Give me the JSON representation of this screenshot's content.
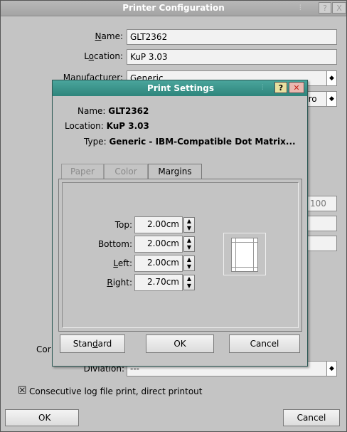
{
  "window": {
    "title": "Printer Configuration",
    "help_glyph": "?",
    "close_glyph": "X",
    "fields": {
      "name_label": "Name:",
      "name_value": "GLT2362",
      "location_label": "Location:",
      "location_value": "KuP 3.03",
      "manufacturer_label": "Manufacturer:",
      "manufacturer_value": "Generic",
      "model_value_fragment": "pro",
      "number_fragment": "100",
      "comment_fragment": "Cor",
      "diviation_label": "Diviation:",
      "diviation_value": "---"
    },
    "checkbox": {
      "checked": true,
      "mark": "☒",
      "label": "Consecutive log file print, direct printout"
    },
    "ok_label": "OK",
    "cancel_label": "Cancel"
  },
  "dialog": {
    "title": "Print Settings",
    "help_glyph": "?",
    "close_glyph": "✕",
    "info": {
      "name_label": "Name:",
      "name_value": "GLT2362",
      "location_label": "Location:",
      "location_value": "KuP 3.03",
      "type_label": "Type:",
      "type_value": "Generic - IBM-Compatible Dot Matrix..."
    },
    "tabs": [
      {
        "label": "Paper",
        "active": false
      },
      {
        "label": "Color",
        "active": false
      },
      {
        "label": "Margins",
        "active": true
      }
    ],
    "margins": {
      "top_label": "Top:",
      "top_value": "2.00cm",
      "bottom_label": "Bottom:",
      "bottom_value": "2.00cm",
      "left_label": "Left:",
      "left_value": "2.00cm",
      "right_label": "Right:",
      "right_value": "2.70cm"
    },
    "buttons": {
      "standard": "Standard",
      "ok": "OK",
      "cancel": "Cancel"
    }
  },
  "colors": {
    "dialog_title_bg": "#2e857c",
    "window_bg": "#c4c4c4",
    "field_bg": "#f2f2f2"
  }
}
